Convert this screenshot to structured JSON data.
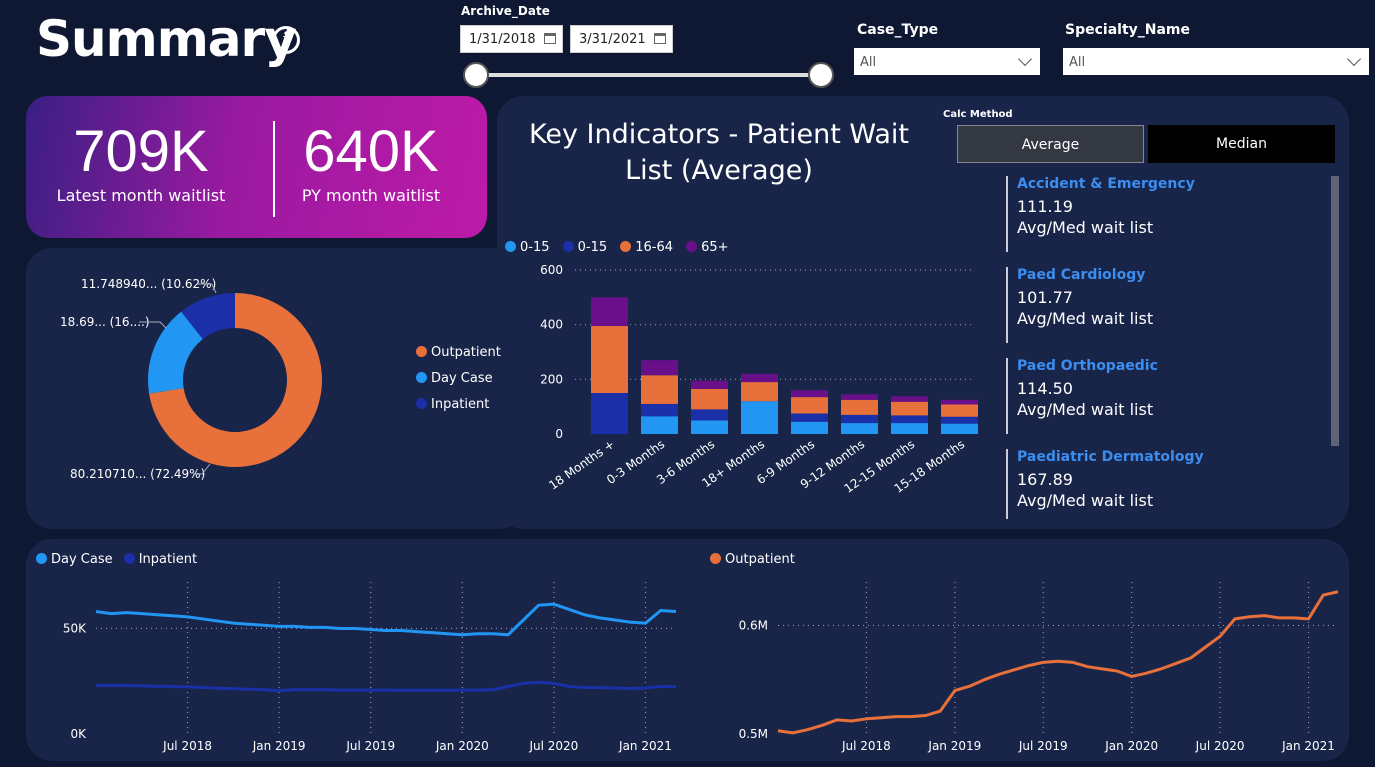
{
  "header": {
    "title": "Summary",
    "info_icon": "info-icon"
  },
  "filters": {
    "archive_date": {
      "label": "Archive_Date",
      "start": "1/31/2018",
      "end": "3/31/2021"
    },
    "case_type": {
      "label": "Case_Type",
      "value": "All"
    },
    "specialty_name": {
      "label": "Specialty_Name",
      "value": "All"
    }
  },
  "kpis": {
    "latest": {
      "value": "709K",
      "label": "Latest month waitlist"
    },
    "py": {
      "value": "640K",
      "label": "PY month waitlist"
    }
  },
  "key_indicators": {
    "title_line1": "Key Indicators - Patient Wait",
    "title_line2": "List (Average)"
  },
  "calc_method": {
    "label": "Calc Method",
    "options": [
      "Average",
      "Median"
    ],
    "selected": "Average"
  },
  "specialty_cards": [
    {
      "name": "Accident & Emergency",
      "value": "111.19",
      "caption": "Avg/Med wait list"
    },
    {
      "name": "Paed Cardiology",
      "value": "101.77",
      "caption": "Avg/Med wait list"
    },
    {
      "name": "Paed Orthopaedic",
      "value": "114.50",
      "caption": "Avg/Med wait list"
    },
    {
      "name": "Paediatric Dermatology",
      "value": "167.89",
      "caption": "Avg/Med wait list"
    }
  ],
  "colors": {
    "outpatient": "#e8703a",
    "day_case": "#2196f3",
    "inpatient": "#1a2fa8",
    "age_0_15a": "#2196f3",
    "age_0_15b": "#1a2fa8",
    "age_16_64": "#e8703a",
    "age_65": "#6a0f8a"
  },
  "chart_data": [
    {
      "type": "pie",
      "variant": "donut",
      "labels": [
        "Outpatient",
        "Day Case",
        "Inpatient"
      ],
      "values": [
        72.49,
        16.89,
        10.62
      ],
      "slice_labels": [
        "80.210710... (72.49%)",
        "18.69... (16....)",
        "11.748940... (10.62%)"
      ],
      "legend": "right"
    },
    {
      "type": "bar",
      "stacked": true,
      "categories": [
        "18 Months +",
        "0-3 Months",
        "3-6 Months",
        "18+ Months",
        "6-9 Months",
        "9-12 Months",
        "12-15 Months",
        "15-18 Months"
      ],
      "series": [
        {
          "name": "0-15",
          "values": [
            0,
            65,
            50,
            120,
            45,
            40,
            40,
            38
          ]
        },
        {
          "name": "0-15",
          "values": [
            150,
            45,
            40,
            0,
            30,
            30,
            28,
            25
          ]
        },
        {
          "name": "16-64",
          "values": [
            245,
            105,
            75,
            70,
            60,
            55,
            50,
            45
          ]
        },
        {
          "name": "65+",
          "values": [
            105,
            55,
            30,
            30,
            25,
            20,
            20,
            17
          ]
        }
      ],
      "ylim": [
        0,
        600
      ],
      "yticks": [
        0,
        200,
        400,
        600
      ],
      "legend": "top-left"
    },
    {
      "type": "line",
      "x": [
        "Jan 2018",
        "Feb 2018",
        "Mar 2018",
        "Apr 2018",
        "May 2018",
        "Jun 2018",
        "Jul 2018",
        "Aug 2018",
        "Sep 2018",
        "Oct 2018",
        "Nov 2018",
        "Dec 2018",
        "Jan 2019",
        "Feb 2019",
        "Mar 2019",
        "Apr 2019",
        "May 2019",
        "Jun 2019",
        "Jul 2019",
        "Aug 2019",
        "Sep 2019",
        "Oct 2019",
        "Nov 2019",
        "Dec 2019",
        "Jan 2020",
        "Feb 2020",
        "Mar 2020",
        "Apr 2020",
        "May 2020",
        "Jun 2020",
        "Jul 2020",
        "Aug 2020",
        "Sep 2020",
        "Oct 2020",
        "Nov 2020",
        "Dec 2020",
        "Jan 2021",
        "Feb 2021",
        "Mar 2021"
      ],
      "series": [
        {
          "name": "Day Case",
          "values": [
            58000,
            57000,
            57500,
            57000,
            56500,
            56000,
            55500,
            54500,
            53500,
            52500,
            52000,
            51500,
            51000,
            51000,
            50500,
            50500,
            50000,
            50000,
            49500,
            49000,
            49000,
            48500,
            48000,
            47500,
            47000,
            47500,
            47500,
            47000,
            54000,
            61000,
            61500,
            59000,
            56500,
            55000,
            54000,
            53000,
            52500,
            58500,
            58000
          ]
        },
        {
          "name": "Inpatient",
          "values": [
            23000,
            23000,
            23000,
            22800,
            22600,
            22500,
            22300,
            22000,
            21700,
            21500,
            21200,
            21000,
            20500,
            21000,
            21000,
            21000,
            20800,
            20800,
            20800,
            20800,
            20700,
            20700,
            20700,
            20700,
            20800,
            20800,
            21000,
            22500,
            24000,
            24500,
            24000,
            22500,
            22000,
            22000,
            21800,
            21500,
            21800,
            22500,
            22500
          ]
        }
      ],
      "yticks": [
        "0K",
        "50K"
      ],
      "xticks": [
        "Jul 2018",
        "Jan 2019",
        "Jul 2019",
        "Jan 2020",
        "Jul 2020",
        "Jan 2021"
      ],
      "legend": "top-left"
    },
    {
      "type": "line",
      "x": [
        "Jan 2018",
        "Feb 2018",
        "Mar 2018",
        "Apr 2018",
        "May 2018",
        "Jun 2018",
        "Jul 2018",
        "Aug 2018",
        "Sep 2018",
        "Oct 2018",
        "Nov 2018",
        "Dec 2018",
        "Jan 2019",
        "Feb 2019",
        "Mar 2019",
        "Apr 2019",
        "May 2019",
        "Jun 2019",
        "Jul 2019",
        "Aug 2019",
        "Sep 2019",
        "Oct 2019",
        "Nov 2019",
        "Dec 2019",
        "Jan 2020",
        "Feb 2020",
        "Mar 2020",
        "Apr 2020",
        "May 2020",
        "Jun 2020",
        "Jul 2020",
        "Aug 2020",
        "Sep 2020",
        "Oct 2020",
        "Nov 2020",
        "Dec 2020",
        "Jan 2021",
        "Feb 2021",
        "Mar 2021"
      ],
      "series": [
        {
          "name": "Outpatient",
          "values": [
            503000,
            501000,
            504000,
            508000,
            513000,
            512000,
            514000,
            515000,
            516000,
            516000,
            517000,
            521000,
            540000,
            544000,
            550000,
            555000,
            559000,
            563000,
            566000,
            567000,
            566000,
            562000,
            560000,
            558000,
            553000,
            556000,
            560000,
            565000,
            570000,
            580000,
            590000,
            606000,
            608000,
            609000,
            607000,
            607000,
            606000,
            628000,
            631000
          ]
        }
      ],
      "yticks": [
        "0.5M",
        "0.6M"
      ],
      "xticks": [
        "Jul 2018",
        "Jan 2019",
        "Jul 2019",
        "Jan 2020",
        "Jul 2020",
        "Jan 2021"
      ],
      "legend": "top-left"
    }
  ]
}
